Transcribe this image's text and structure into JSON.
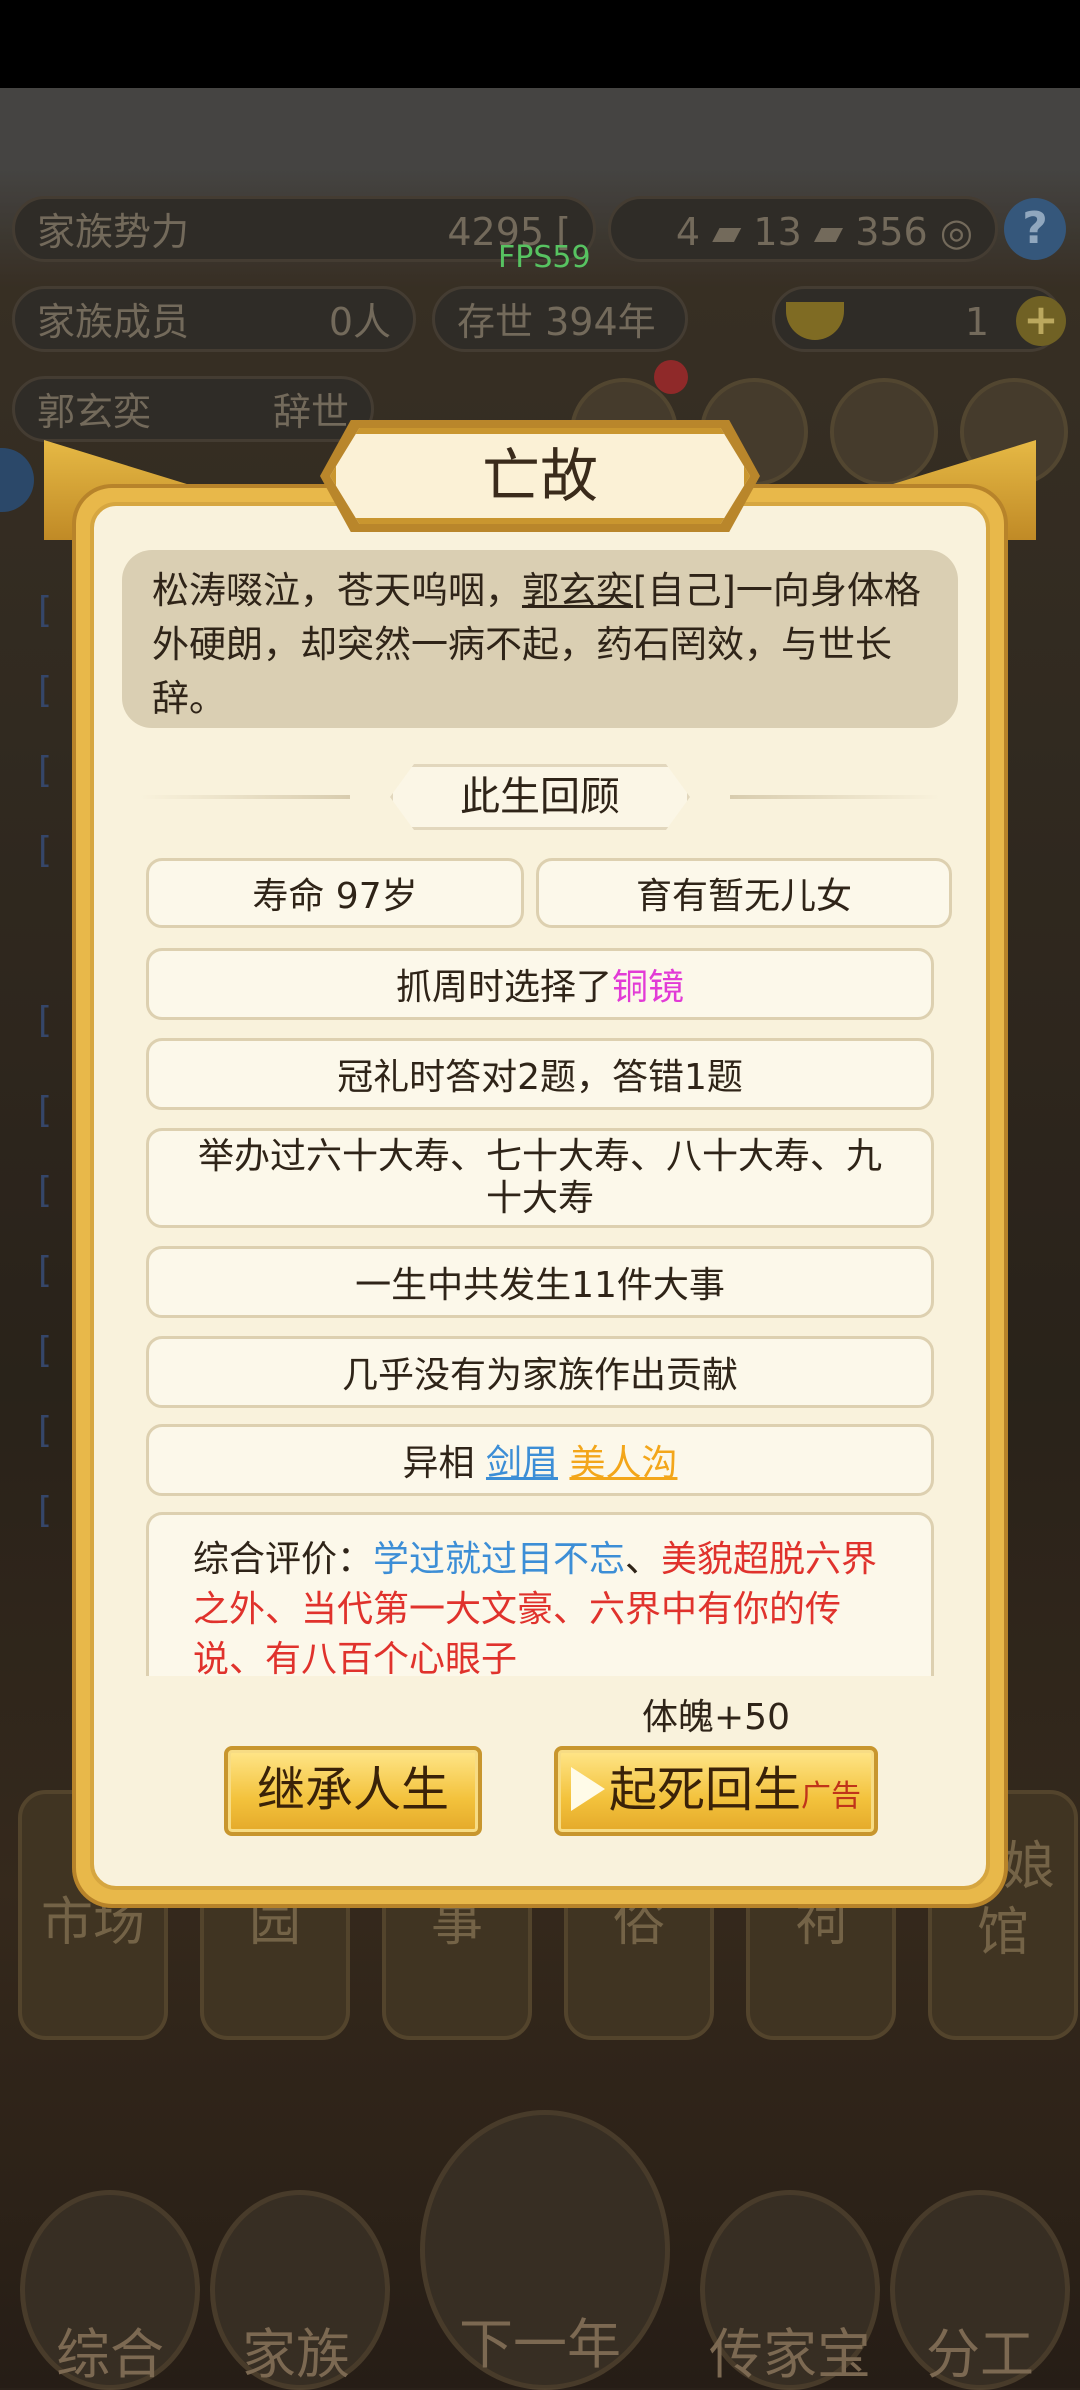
{
  "hud": {
    "clan_power_label": "家族势力",
    "clan_power_value": "4295 [",
    "fps": "FPS59",
    "res_a": "4",
    "res_b": "13",
    "res_c": "356",
    "members_label": "家族成员",
    "members_value": "0人",
    "years_label": "存世",
    "years_value": "394年",
    "gold_value": "1",
    "person_name": "郭玄奕",
    "person_status": "辞世"
  },
  "background_buildings": [
    "市场",
    "园",
    "事",
    "俗",
    "祠",
    "红娘馆"
  ],
  "bottom_nav": [
    "综合",
    "家族",
    "下一年",
    "传家宝",
    "分工"
  ],
  "modal": {
    "title": "亡故",
    "epitaph": {
      "pre": "松涛啜泣，苍天呜咽，",
      "name": "郭玄奕",
      "post": "[自己]一向身体格外硬朗，却突然一病不起，药石罔效，与世长辞。"
    },
    "section_title": "此生回顾",
    "lifespan": "寿命 97岁",
    "children": "育有暂无儿女",
    "zhuazhou_pre": "抓周时选择了",
    "zhuazhou_item": "铜镜",
    "guanli": "冠礼时答对2题，答错1题",
    "birthdays": "举办过六十大寿、七十大寿、八十大寿、九十大寿",
    "events": "一生中共发生11件大事",
    "contribution": "几乎没有为家族作出贡献",
    "traits_label": "异相",
    "trait_1": "剑眉",
    "trait_2": "美人沟",
    "evaluation_label": "综合评价：",
    "evaluation_blue": "学过就过目不忘",
    "evaluation_sep": "、",
    "evaluation_red": "美貌超脱六界之外、当代第一大文豪、六界中有你的传说、有八百个心眼子",
    "reward": "体魄+50",
    "btn_inherit": "继承人生",
    "btn_revive": "起死回生",
    "btn_revive_ad": "广告"
  },
  "colors": {
    "modal_gold": "#e8b84a",
    "panel_cream": "#f9f2dc",
    "accent_pink": "#e23bd6",
    "accent_blue": "#3c8ed6",
    "accent_gold": "#f3a61a",
    "accent_red": "#e0322c"
  }
}
